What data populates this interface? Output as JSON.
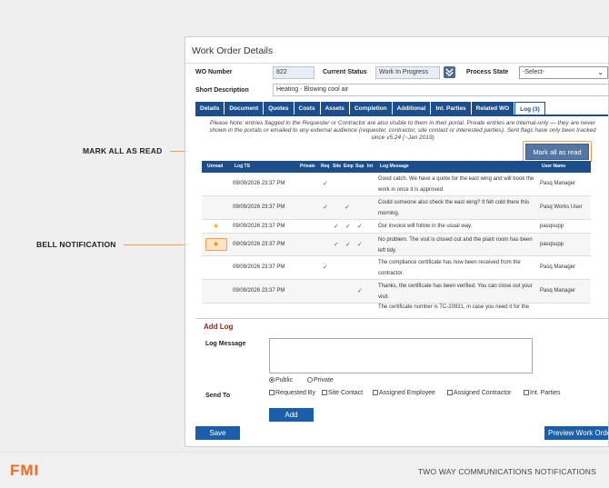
{
  "window": {
    "title": "Work Order Details"
  },
  "header": {
    "wo_number_label": "WO Number",
    "wo_number_value": "822",
    "current_status_label": "Current Status",
    "current_status_value": "Work In Progress",
    "process_state_label": "Process State",
    "process_state_value": "-Select-",
    "short_description_label": "Short Description",
    "short_description_value": "Heating - Blowing cool air"
  },
  "tabs": [
    "Details",
    "Document",
    "Quotes",
    "Costs",
    "Assets",
    "Completion",
    "Additional",
    "Int. Parties",
    "Related WO",
    "Log (3)"
  ],
  "active_tab": "Log (3)",
  "log": {
    "note": "Please Note: entries flagged to the Requester or Contractor are also visible to them in their portal. Private entries are internal-only — they are never shown in the portals or emailed to any external audience (requester, contractor, site contact or interested parties). Sent flags have only been tracked since v5.24 (~Jan 2019)",
    "mark_all_label": "Mark all as read",
    "columns": [
      "Unread",
      "Log TS",
      "Private",
      "Req",
      "Site",
      "Emp",
      "Sup",
      "Int",
      "Log Message",
      "User Name"
    ],
    "rows": [
      {
        "unread": "",
        "ts": "09/09/2026 23:37 PM",
        "checks": [
          "",
          "✓",
          "",
          "",
          "",
          ""
        ],
        "message": "Good catch. We have a quote for the east wing and will book the work in once it is approved.",
        "user": "Pasq Manager"
      },
      {
        "unread": "",
        "ts": "09/09/2026 23:37 PM",
        "checks": [
          "",
          "✓",
          "",
          "✓",
          "",
          ""
        ],
        "message": "Could someone also check the east wing? It felt cold there this morning.",
        "user": "Pasq Works User"
      },
      {
        "unread": "★",
        "ts": "09/09/2026 23:37 PM",
        "checks": [
          "",
          "",
          "",
          "✓",
          "✓",
          "✓"
        ],
        "message": "Our invoice will follow in the usual way.",
        "user": "pasqsupp"
      },
      {
        "unread": "★",
        "ts": "09/09/2026 23:37 PM",
        "checks": [
          "",
          "",
          "",
          "✓",
          "✓",
          "✓"
        ],
        "message": "No problem. The visit is closed out and the plant room has been left tidy.",
        "user": "pasqsupp"
      },
      {
        "unread": "",
        "ts": "09/09/2026 23:37 PM",
        "checks": [
          "",
          "✓",
          "",
          "",
          "",
          ""
        ],
        "message": "The compliance certificate has now been received from the contractor.",
        "user": "Pasq Manager"
      },
      {
        "unread": "",
        "ts": "09/09/2026 23:37 PM",
        "checks": [
          "",
          "",
          "",
          "",
          "",
          "✓"
        ],
        "message": "Thanks, the certificate has been verified. You can close out your visit.",
        "user": "Pasq Manager"
      },
      {
        "unread": "",
        "ts": "",
        "checks": [
          "",
          "",
          "",
          "",
          "",
          ""
        ],
        "message": "The certificate number is TC-20931, in case you need it for the",
        "user": ""
      }
    ]
  },
  "add_log": {
    "title": "Add Log",
    "message_label": "Log Message",
    "send_to_label": "Send To",
    "visibility": [
      "Public",
      "Private"
    ],
    "recipients": [
      "Requested By",
      "Site Contact",
      "Assigned Employee",
      "Assigned Contractor",
      "Int. Parties"
    ],
    "add_label": "Add"
  },
  "buttons": {
    "save": "Save",
    "preview": "Preview Work Order"
  },
  "callouts": {
    "mark_all": "MARK ALL AS READ",
    "bell": "BELL NOTIFICATION"
  },
  "footer": {
    "logo": "FMI",
    "caption": "TWO WAY COMMUNICATIONS NOTIFICATIONS"
  },
  "colors": {
    "primary": "#1b4e8a",
    "accent": "#f39c44",
    "brand": "#f26b21"
  }
}
